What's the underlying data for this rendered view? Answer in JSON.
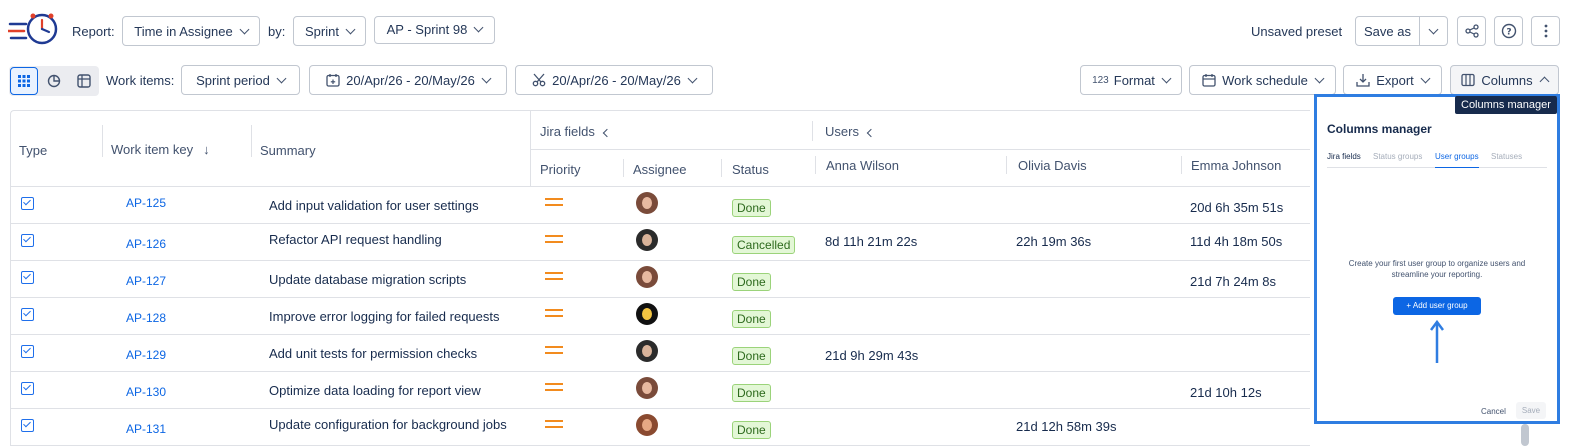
{
  "toolbar": {
    "report_label": "Report:",
    "report_value": "Time in Assignee",
    "by_label": "by:",
    "by_value": "Sprint",
    "sprint_value": "AP - Sprint 98",
    "preset_status": "Unsaved preset",
    "save_as_label": "Save as"
  },
  "filters": {
    "work_items_label": "Work items:",
    "work_items_value": "Sprint period",
    "date_range": "20/Apr/26 - 20/May/26",
    "cut_range": "20/Apr/26 - 20/May/26",
    "format_label": "Format",
    "format_prefix": "123",
    "work_schedule_label": "Work schedule",
    "export_label": "Export",
    "columns_label": "Columns"
  },
  "table": {
    "headers": {
      "type": "Type",
      "key": "Work item key",
      "summary": "Summary",
      "jira_fields": "Jira fields",
      "users": "Users",
      "priority": "Priority",
      "assignee": "Assignee",
      "status": "Status",
      "user1": "Anna Wilson",
      "user2": "Olivia Davis",
      "user3": "Emma Johnson"
    },
    "rows": [
      {
        "key": "AP-125",
        "summary": "Add input validation for user settings",
        "status": "Done",
        "u1": "",
        "u2": "",
        "u3": "20d 6h 35m 51s"
      },
      {
        "key": "AP-126",
        "summary": "Refactor API request handling",
        "status": "Cancelled",
        "u1": "8d 11h 21m 22s",
        "u2": "22h 19m 36s",
        "u3": "11d 4h 18m 50s"
      },
      {
        "key": "AP-127",
        "summary": "Update database migration scripts",
        "status": "Done",
        "u1": "",
        "u2": "",
        "u3": "21d 7h 24m 8s"
      },
      {
        "key": "AP-128",
        "summary": "Improve error logging for failed requests",
        "status": "Done",
        "u1": "",
        "u2": "",
        "u3": ""
      },
      {
        "key": "AP-129",
        "summary": "Add unit tests for permission checks",
        "status": "Done",
        "u1": "21d 9h 29m 43s",
        "u2": "",
        "u3": ""
      },
      {
        "key": "AP-130",
        "summary": "Optimize data loading for report view",
        "status": "Done",
        "u1": "",
        "u2": "",
        "u3": "21d 10h 12s"
      },
      {
        "key": "AP-131",
        "summary": "Update configuration for background jobs",
        "status": "Done",
        "u1": "",
        "u2": "21d 12h 58m 39s",
        "u3": ""
      }
    ]
  },
  "columns_manager": {
    "tooltip": "Columns manager",
    "title": "Columns manager",
    "tabs": [
      "Jira fields",
      "Status groups",
      "User groups",
      "Statuses"
    ],
    "empty_text_line1": "Create your first user group to organize users and",
    "empty_text_line2": "streamline your reporting.",
    "add_button": "+ Add user group",
    "cancel": "Cancel",
    "save": "Save"
  },
  "colors": {
    "accent": "#0c66e4",
    "highlight_border": "#2f7de1",
    "priority": "#f28b1e",
    "done_bg": "#e3f7d6"
  }
}
